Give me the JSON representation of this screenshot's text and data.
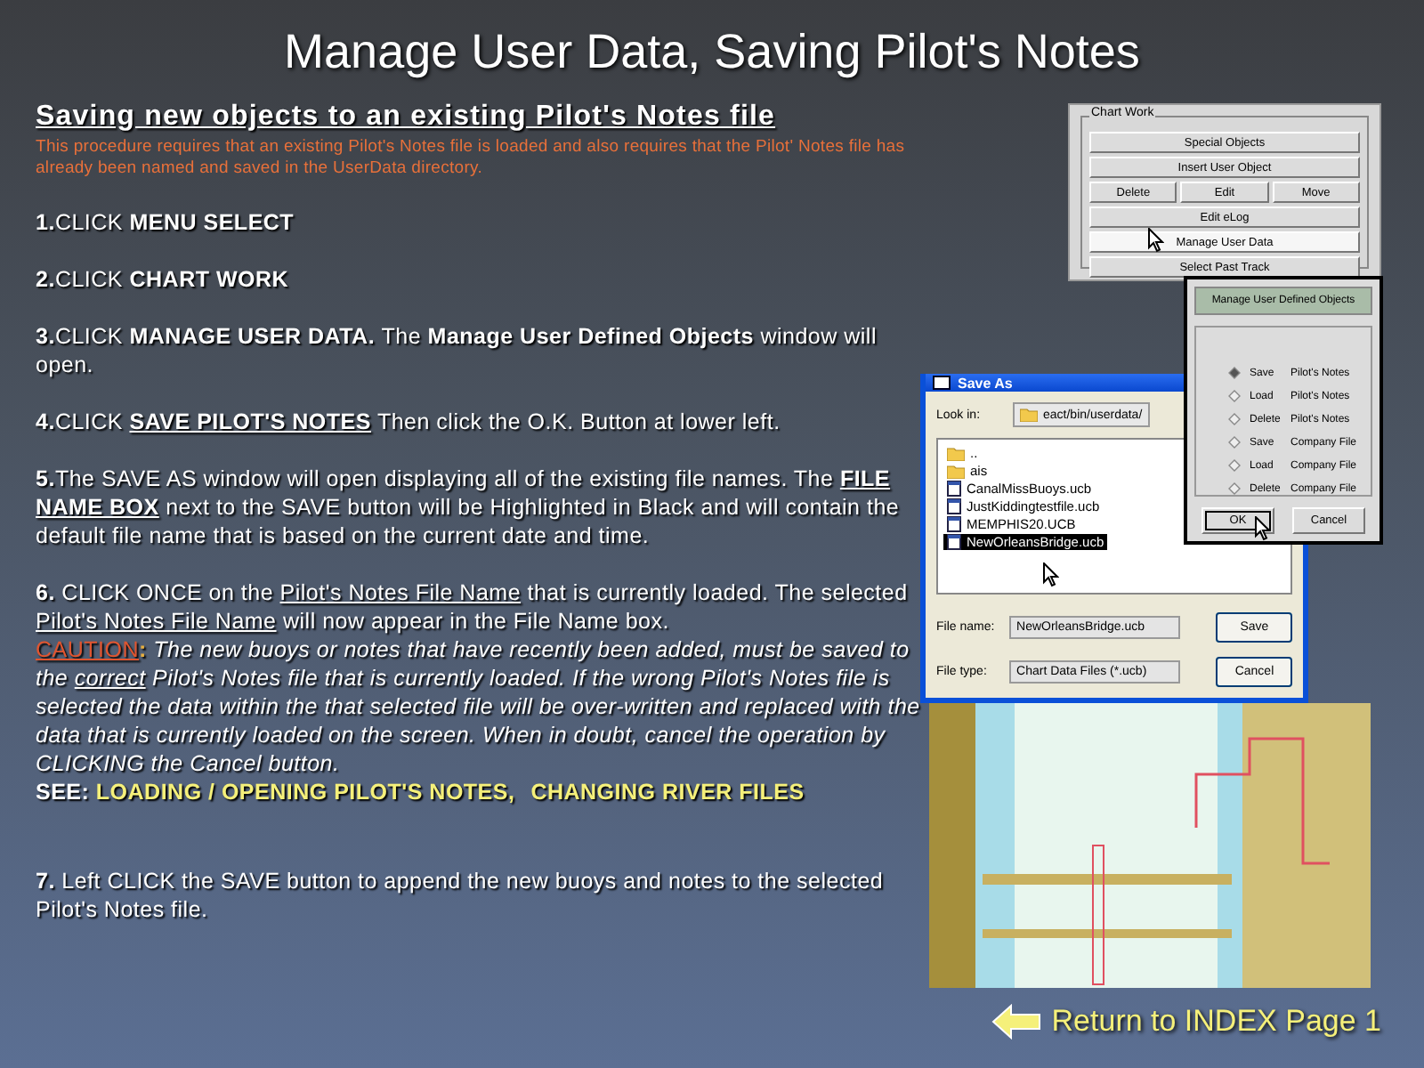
{
  "title": "Manage User Data, Saving Pilot's Notes",
  "heading": "Saving new objects to an existing Pilot's Notes file",
  "note": "This procedure requires that an existing Pilot's Notes file is loaded and also requires that the Pilot' Notes file has already been named and saved in the UserData directory.",
  "paragraphs": [
    {
      "kind": "step",
      "segments": [
        {
          "kind": "bold",
          "text": "1."
        },
        {
          "kind": "plain",
          "text": "CLICK "
        },
        {
          "kind": "bold",
          "text": "MENU SELECT"
        }
      ]
    },
    {
      "kind": "step",
      "segments": [
        {
          "kind": "bold",
          "text": "2."
        },
        {
          "kind": "plain",
          "text": "CLICK "
        },
        {
          "kind": "bold",
          "text": "CHART WORK"
        }
      ]
    },
    {
      "kind": "step",
      "segments": [
        {
          "kind": "bold",
          "text": "3."
        },
        {
          "kind": "plain",
          "text": "CLICK "
        },
        {
          "kind": "bold",
          "text": "MANAGE USER DATA.  "
        },
        {
          "kind": "plain",
          "text": "The "
        },
        {
          "kind": "bold",
          "text": "Manage User Defined Objects"
        },
        {
          "kind": "plain",
          "text": " window will open."
        }
      ]
    },
    {
      "kind": "step",
      "segments": [
        {
          "kind": "bold",
          "text": "4."
        },
        {
          "kind": "plain",
          "text": "CLICK "
        },
        {
          "kind": "bold_underline",
          "text": "SAVE PILOT'S NOTES"
        },
        {
          "kind": "plain",
          "text": " Then click the O.K. Button at lower left."
        }
      ]
    },
    {
      "kind": "step",
      "segments": [
        {
          "kind": "bold",
          "text": "5."
        },
        {
          "kind": "plain",
          "text": "The SAVE AS window will open displaying all of the existing file names. The "
        },
        {
          "kind": "bold_underline",
          "text": "FILE NAME BOX"
        },
        {
          "kind": "plain",
          "text": " next to the SAVE button will be Highlighted in Black and will contain the default file name that is based on the current date and time."
        }
      ]
    },
    {
      "kind": "step",
      "segments": [
        {
          "kind": "bold",
          "text": "6."
        },
        {
          "kind": "plain",
          "text": " CLICK ONCE on the "
        },
        {
          "kind": "underline",
          "text": "Pilot's Notes File Name"
        },
        {
          "kind": "plain",
          "text": " that is currently loaded. The selected "
        },
        {
          "kind": "underline",
          "text": "Pilot's Notes File Name"
        },
        {
          "kind": "plain",
          "text": " will now appear in the File Name box."
        }
      ]
    },
    {
      "kind": "follow",
      "segments": [
        {
          "kind": "caution",
          "text": "CAUTION"
        },
        {
          "kind": "caution_mark",
          "text": ": "
        },
        {
          "kind": "italic",
          "text": "The new buoys or notes that have recently been added, must be saved to the "
        },
        {
          "kind": "italic_underline",
          "text": "correct"
        },
        {
          "kind": "italic",
          "text": " Pilot's Notes file that is currently loaded.  If the wrong Pilot's Notes file is selected the data within the that selected file will be over-written and replaced with the data that is currently loaded on the screen.  When in doubt, cancel  the operation by CLICKING the Cancel button."
        }
      ]
    },
    {
      "kind": "follow",
      "segments": [
        {
          "kind": "bold",
          "text": "SEE: "
        },
        {
          "kind": "link",
          "text": "LOADING / OPENING PILOT'S NOTES,"
        },
        {
          "kind": "link",
          "text": "CHANGING RIVER FILES"
        }
      ]
    },
    {
      "kind": "far",
      "segments": [
        {
          "kind": "bold",
          "text": "7."
        },
        {
          "kind": "plain",
          "text": " Left CLICK the SAVE button to append the new buoys and notes to the selected Pilot's Notes file."
        }
      ]
    }
  ],
  "chart_work": {
    "title": "Chart Work",
    "rows": [
      [
        {
          "label": "Special Objects",
          "highlighted": false
        }
      ],
      [
        {
          "label": "Insert User Object",
          "highlighted": false
        }
      ],
      [
        {
          "label": "Delete",
          "highlighted": false
        },
        {
          "label": "Edit",
          "highlighted": false
        },
        {
          "label": "Move",
          "highlighted": false
        }
      ],
      [
        {
          "label": "Edit eLog",
          "highlighted": false
        }
      ],
      [
        {
          "label": "Manage User Data",
          "highlighted": true
        }
      ],
      [
        {
          "label": "Select Past Track",
          "highlighted": false
        }
      ]
    ]
  },
  "manage_dialog": {
    "title": "Manage User Defined Objects",
    "options": [
      {
        "verb": "Save",
        "object": "Pilot's Notes",
        "selected": true
      },
      {
        "verb": "Load",
        "object": "Pilot's Notes",
        "selected": false
      },
      {
        "verb": "Delete",
        "object": "Pilot's Notes",
        "selected": false
      },
      {
        "verb": "Save",
        "object": "Company File",
        "selected": false
      },
      {
        "verb": "Load",
        "object": "Company File",
        "selected": false
      },
      {
        "verb": "Delete",
        "object": "Company File",
        "selected": false
      }
    ],
    "buttons": [
      {
        "label": "OK",
        "focused": true
      },
      {
        "label": "Cancel",
        "focused": false
      }
    ]
  },
  "save_as": {
    "title": "Save As",
    "look_in_label": "Look in:",
    "look_in": "eact/bin/userdata/",
    "files": [
      {
        "kind": "folder",
        "name": "..",
        "selected": false
      },
      {
        "kind": "folder",
        "name": "ais",
        "selected": false
      },
      {
        "kind": "file",
        "name": "CanalMissBuoys.ucb",
        "selected": false
      },
      {
        "kind": "file",
        "name": "JustKiddingtestfile.ucb",
        "selected": false
      },
      {
        "kind": "file",
        "name": "MEMPHIS20.UCB",
        "selected": false
      },
      {
        "kind": "file",
        "name": "NewOrleansBridge.ucb",
        "selected": true
      }
    ],
    "file_name_label": "File name:",
    "file_name": "NewOrleansBridge.ucb",
    "file_type_label": "File type:",
    "file_type": "Chart Data Files (*.ucb)",
    "buttons": [
      "Save",
      "Cancel"
    ]
  },
  "return_link": "Return to INDEX Page 1"
}
